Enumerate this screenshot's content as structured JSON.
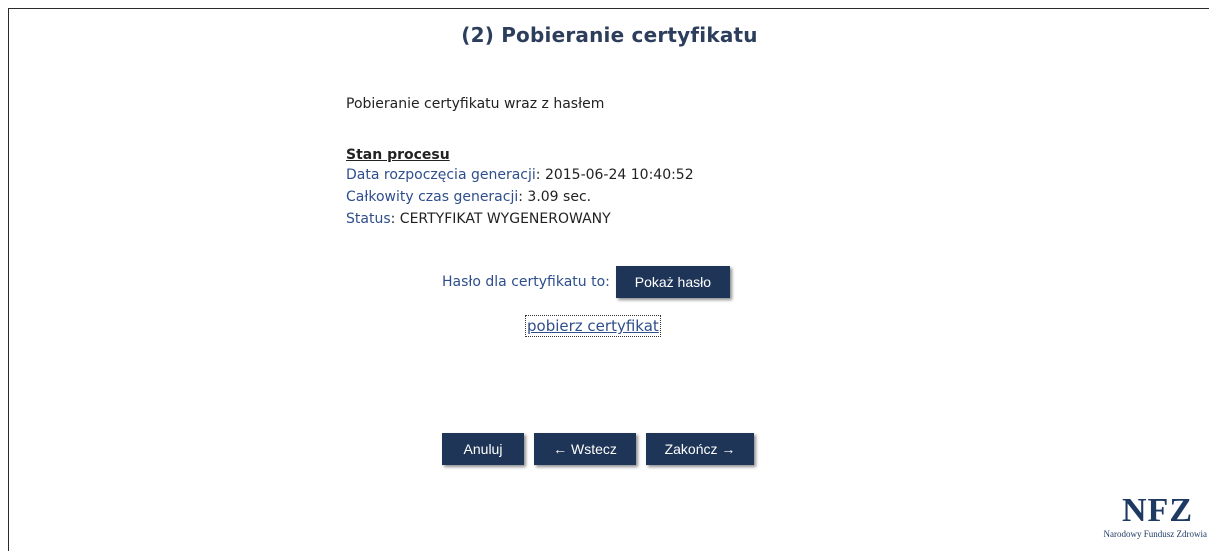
{
  "page": {
    "title": "(2) Pobieranie certyfikatu",
    "lead": "Pobieranie certyfikatu wraz z hasłem"
  },
  "state": {
    "heading": "Stan procesu",
    "start_label": "Data rozpoczęcia generacji",
    "start_value": "2015-06-24 10:40:52",
    "duration_label": "Całkowity czas generacji",
    "duration_value": "3.09 sec.",
    "status_label": "Status",
    "status_value": "CERTYFIKAT WYGENEROWANY"
  },
  "password": {
    "label": "Hasło dla certyfikatu to:",
    "button": "Pokaż hasło"
  },
  "download_link": "pobierz certyfikat",
  "nav": {
    "cancel": "Anuluj",
    "back": "← Wstecz",
    "finish": "Zakończ →"
  },
  "logo": {
    "mark": "NFZ",
    "subtitle": "Narodowy Fundusz Zdrowia"
  },
  "colors": {
    "title": "#2c3e5c",
    "label_blue": "#2f4e8c",
    "button_bg": "#1f3557",
    "button_text": "#ffffff"
  }
}
